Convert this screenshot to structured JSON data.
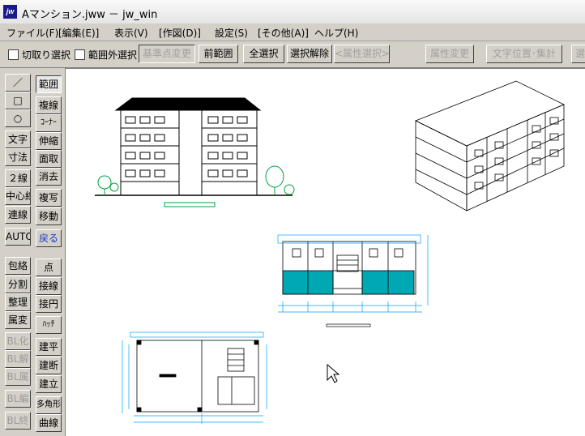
{
  "window": {
    "title": "Aマンション.jww － jw_win",
    "icon": "jw-app-icon",
    "icon_label": "jw"
  },
  "menu": [
    "ファイル(F)",
    "[編集(E)]",
    "表示(V)",
    "[作図(D)]",
    "設定(S)",
    "[その他(A)]",
    "ヘルプ(H)"
  ],
  "toolbar": {
    "check_cut": "切取り選択",
    "check_outside": "範囲外選択",
    "btn_base": "基準点変更",
    "btn_prev": "前範囲",
    "btn_all": "全選択",
    "btn_clear": "選択解除",
    "btn_attr_select": "<属性選択>",
    "btn_attr_change": "属性変更",
    "btn_text_pos": "文字位置･集計",
    "btn_cut_end": "選"
  },
  "left_tools": {
    "col1": [
      "／",
      "□",
      "○",
      "文字",
      "寸法",
      "２線",
      "中心線",
      "連線",
      "AUTO",
      "包絡",
      "分割",
      "整理",
      "属変",
      "BL化",
      "BL解",
      "BL属",
      "BL編",
      "BL終"
    ],
    "col2": [
      "範囲",
      "複線",
      "ｺｰﾅｰ",
      "伸縮",
      "面取",
      "消去",
      "複写",
      "移動",
      "戻る",
      "点",
      "接線",
      "接円",
      "ﾊｯﾁ",
      "建平",
      "建断",
      "建立",
      "多角形",
      "曲線"
    ]
  },
  "colors": {
    "accent_cyan": "#00a8b4",
    "drawing_line": "#000000",
    "tree_green": "#00a040",
    "dim_blue": "#00a0ff"
  },
  "canvas": {
    "icon": "mouse-cursor-icon"
  }
}
